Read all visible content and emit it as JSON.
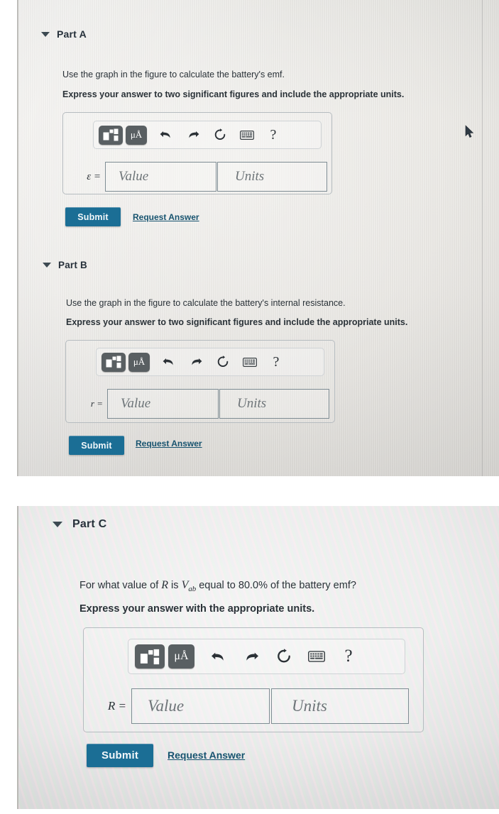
{
  "page": {
    "background_color": "#ffffff",
    "panel_color": "#e9e8e4",
    "accent_color": "#1b6e95",
    "link_color": "#17536f"
  },
  "toolbar_icons": [
    {
      "name": "template-answer-icon",
      "glyph": "template"
    },
    {
      "name": "units-mu-angstrom-icon",
      "glyph": "μÅ"
    },
    {
      "name": "undo-icon",
      "glyph": "↶"
    },
    {
      "name": "redo-icon",
      "glyph": "↷"
    },
    {
      "name": "reset-icon",
      "glyph": "↻"
    },
    {
      "name": "keyboard-icon",
      "glyph": "⌨"
    },
    {
      "name": "help-icon",
      "glyph": "?"
    }
  ],
  "parts": [
    {
      "id": "part-a",
      "header": "Part A",
      "prompt": "Use the graph in the figure to calculate the battery's emf.",
      "instruction": "Express your answer to two significant figures and include the appropriate units.",
      "field_label": "ε =",
      "value_placeholder": "Value",
      "units_placeholder": "Units",
      "submit_label": "Submit",
      "request_label": "Request Answer"
    },
    {
      "id": "part-b",
      "header": "Part B",
      "prompt": "Use the graph in the figure to calculate the battery's internal resistance.",
      "instruction": "Express your answer to two significant figures and include the appropriate units.",
      "field_label": "r =",
      "value_placeholder": "Value",
      "units_placeholder": "Units",
      "submit_label": "Submit",
      "request_label": "Request Answer"
    },
    {
      "id": "part-c",
      "header": "Part C",
      "prompt_pre": "For what value of ",
      "prompt_var1": "R",
      "prompt_mid": " is ",
      "prompt_var2": "V",
      "prompt_var2_sub": "ab",
      "prompt_post": " equal to 80.0% of the battery emf?",
      "instruction": "Express your answer with the appropriate units.",
      "field_label": "R =",
      "value_placeholder": "Value",
      "units_placeholder": "Units",
      "submit_label": "Submit",
      "request_label": "Request Answer"
    }
  ]
}
